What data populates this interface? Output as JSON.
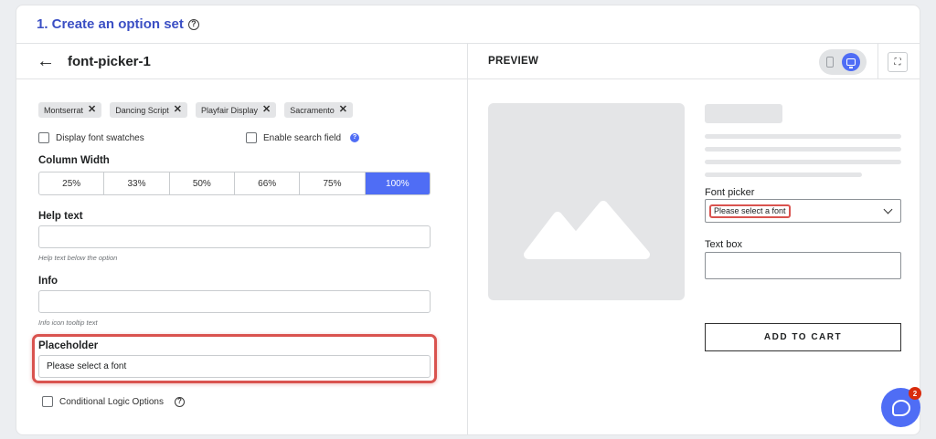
{
  "page": {
    "title": "1. Create an option set"
  },
  "editor": {
    "name": "font-picker-1",
    "fonts": [
      "Montserrat",
      "Dancing Script",
      "Playfair Display",
      "Sacramento"
    ],
    "display_swatches_label": "Display font swatches",
    "enable_search_label": "Enable search field",
    "column_width_label": "Column Width",
    "column_widths": [
      "25%",
      "33%",
      "50%",
      "66%",
      "75%",
      "100%"
    ],
    "column_width_selected": "100%",
    "help_text_label": "Help text",
    "help_text_value": "",
    "help_text_hint": "Help text below the option",
    "info_label": "Info",
    "info_value": "",
    "info_hint": "Info icon tooltip text",
    "placeholder_label": "Placeholder",
    "placeholder_value": "Please select a font",
    "conditional_logic_label": "Conditional Logic Options"
  },
  "preview": {
    "title": "PREVIEW",
    "font_picker_label": "Font picker",
    "font_picker_placeholder": "Please select a font",
    "text_box_label": "Text box",
    "add_to_cart": "ADD TO CART"
  },
  "chat": {
    "badge_count": "2"
  },
  "colors": {
    "accent": "#4f6df5",
    "title": "#3b4fc4",
    "highlight": "#d9534f"
  }
}
